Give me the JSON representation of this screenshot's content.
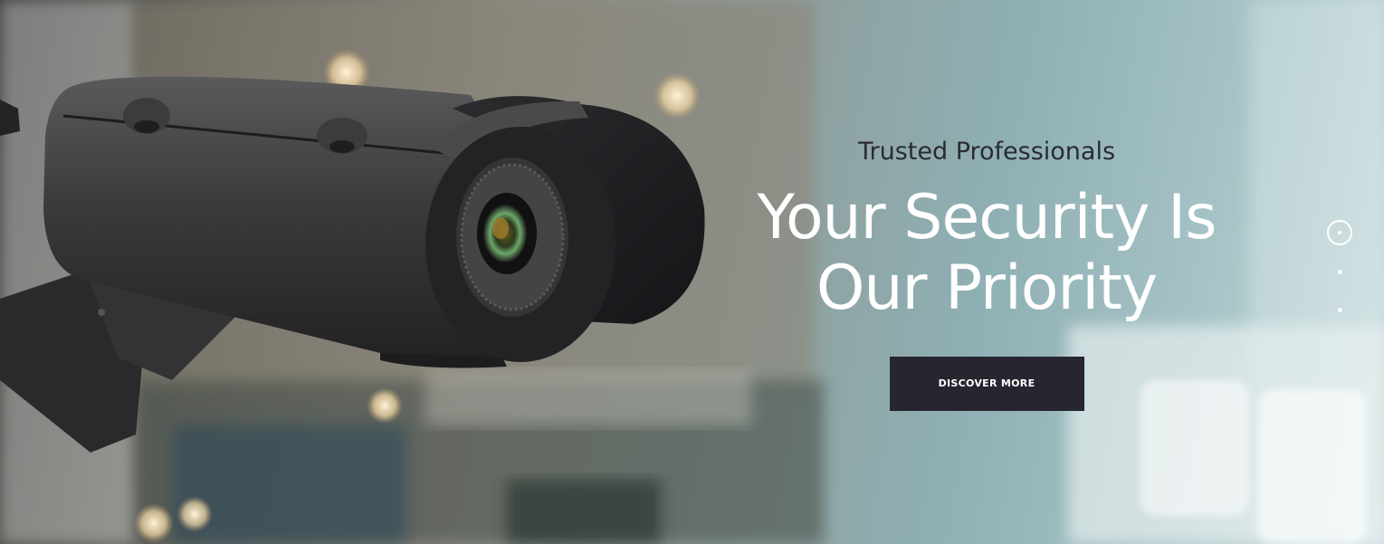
{
  "hero": {
    "kicker": "Trusted Professionals",
    "headline_line1": "Your Security Is",
    "headline_line2": "Our Priority",
    "cta_label": "DISCOVER MORE"
  },
  "slider": {
    "active_index": 1,
    "total": 3
  },
  "colors": {
    "cta_background": "#27252f",
    "kicker_text": "#2a2b33",
    "headline_text": "#ffffff"
  },
  "icons": {
    "background_image": "security-camera-photo"
  }
}
